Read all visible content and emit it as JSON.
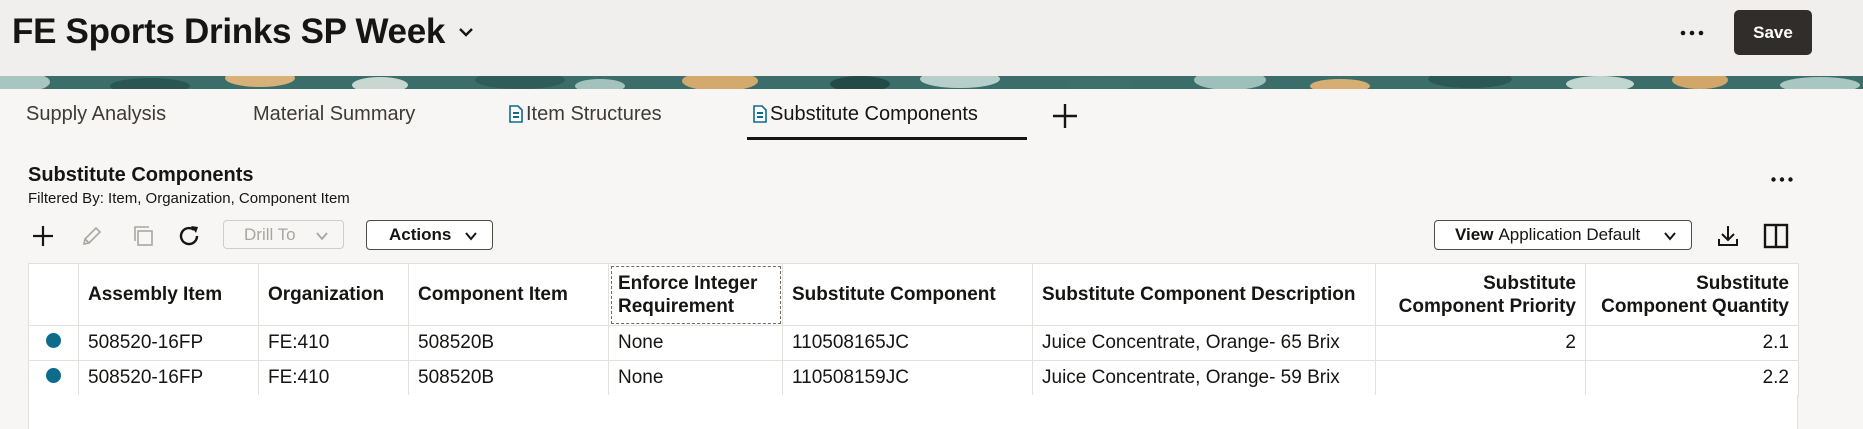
{
  "header": {
    "title": "FE Sports Drinks SP Week",
    "save_label": "Save"
  },
  "tabs": [
    {
      "label": "Supply Analysis",
      "has_icon": false,
      "active": false
    },
    {
      "label": "Material Summary",
      "has_icon": false,
      "active": false
    },
    {
      "label": "Item Structures",
      "has_icon": true,
      "active": false
    },
    {
      "label": "Substitute Components",
      "has_icon": true,
      "active": true
    }
  ],
  "section": {
    "title": "Substitute Components",
    "filter": "Filtered By: Item, Organization, Component Item"
  },
  "toolbar": {
    "drill_label": "Drill To",
    "actions_label": "Actions",
    "view_bold": "View",
    "view_rest": "Application Default"
  },
  "table": {
    "columns": [
      "Assembly Item",
      "Organization",
      "Component Item",
      "Enforce Integer Requirement",
      "Substitute Component",
      "Substitute Component Description",
      "Substitute Component Priority",
      "Substitute Component Quantity"
    ],
    "rows": [
      [
        "508520-16FP",
        "FE:410",
        "508520B",
        "None",
        "110508165JC",
        "Juice Concentrate, Orange- 65 Brix",
        "2",
        "2.1"
      ],
      [
        "508520-16FP",
        "FE:410",
        "508520B",
        "None",
        "110508159JC",
        "Juice Concentrate, Orange- 59 Brix",
        "",
        "2.2"
      ]
    ]
  },
  "colors": {
    "accent": "#0e6b8c",
    "save_bg": "#312d2a",
    "banner": "#3b6e6a"
  }
}
